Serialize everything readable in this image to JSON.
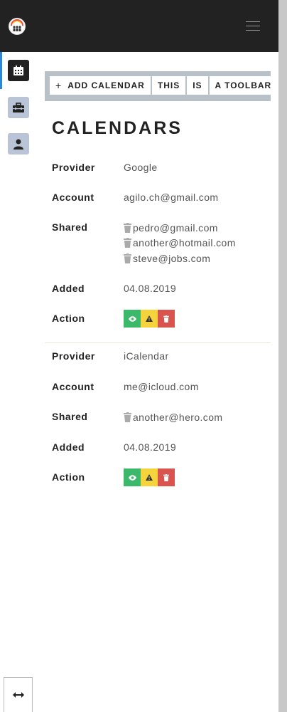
{
  "header": {
    "menu_icon": "hamburger-icon",
    "logo_icon": "app-logo-icon"
  },
  "sidebar": {
    "items": [
      {
        "icon": "calendar-icon",
        "active": true
      },
      {
        "icon": "toolbox-icon",
        "active": false
      },
      {
        "icon": "user-icon",
        "active": false
      }
    ]
  },
  "toolbar": {
    "add_icon": "+",
    "add_label": "ADD CALENDAR",
    "btn2": "THIS",
    "btn3": "IS",
    "btn4": "A TOOLBAR"
  },
  "page": {
    "title": "CALENDARS"
  },
  "labels": {
    "provider": "Provider",
    "account": "Account",
    "shared": "Shared",
    "added": "Added",
    "action": "Action"
  },
  "calendars": [
    {
      "provider": "Google",
      "account": "agilo.ch@gmail.com",
      "shared": [
        "pedro@gmail.com",
        "another@hotmail.com",
        "steve@jobs.com"
      ],
      "added": "04.08.2019"
    },
    {
      "provider": "iCalendar",
      "account": "me@icloud.com",
      "shared": [
        "another@hero.com"
      ],
      "added": "04.08.2019"
    }
  ],
  "colors": {
    "view": "#3cb86b",
    "warn": "#f5d33d",
    "delete": "#d9534f",
    "active_indicator": "#2a88d8"
  },
  "footer": {
    "resize_icon": "resize-horizontal-icon"
  }
}
